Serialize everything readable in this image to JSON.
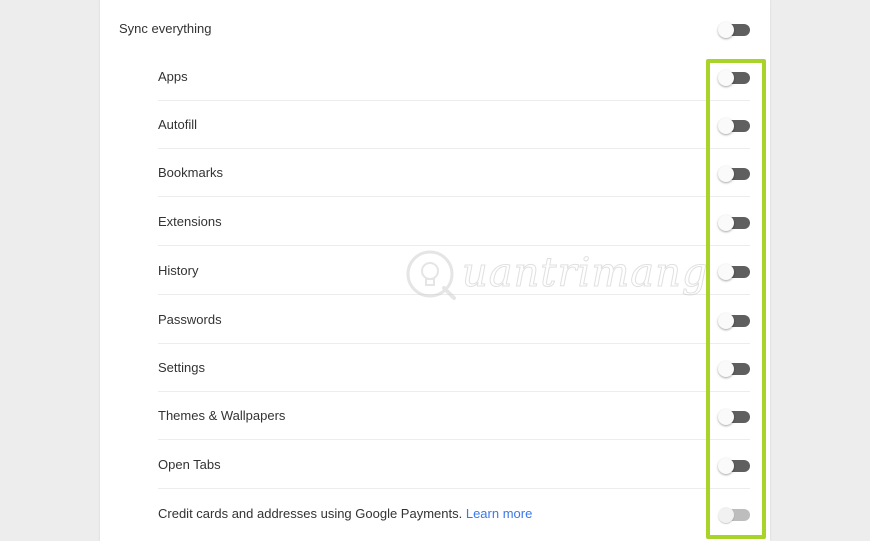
{
  "sync_everything": {
    "label": "Sync everything",
    "enabled": false
  },
  "items": [
    {
      "label": "Apps",
      "enabled": false
    },
    {
      "label": "Autofill",
      "enabled": false
    },
    {
      "label": "Bookmarks",
      "enabled": false
    },
    {
      "label": "Extensions",
      "enabled": false
    },
    {
      "label": "History",
      "enabled": false
    },
    {
      "label": "Passwords",
      "enabled": false
    },
    {
      "label": "Settings",
      "enabled": false
    },
    {
      "label": "Themes & Wallpapers",
      "enabled": false
    },
    {
      "label": "Open Tabs",
      "enabled": false
    }
  ],
  "payments": {
    "label": "Credit cards and addresses using Google Payments.",
    "link": "Learn more",
    "enabled": false,
    "disabled": true
  },
  "watermark": {
    "text": "uantrimang",
    "icon": "lightbulb-icon"
  },
  "colors": {
    "highlight": "#a8d42a",
    "link": "#3b78e7",
    "toggle_off_track": "#5f5f5f"
  }
}
